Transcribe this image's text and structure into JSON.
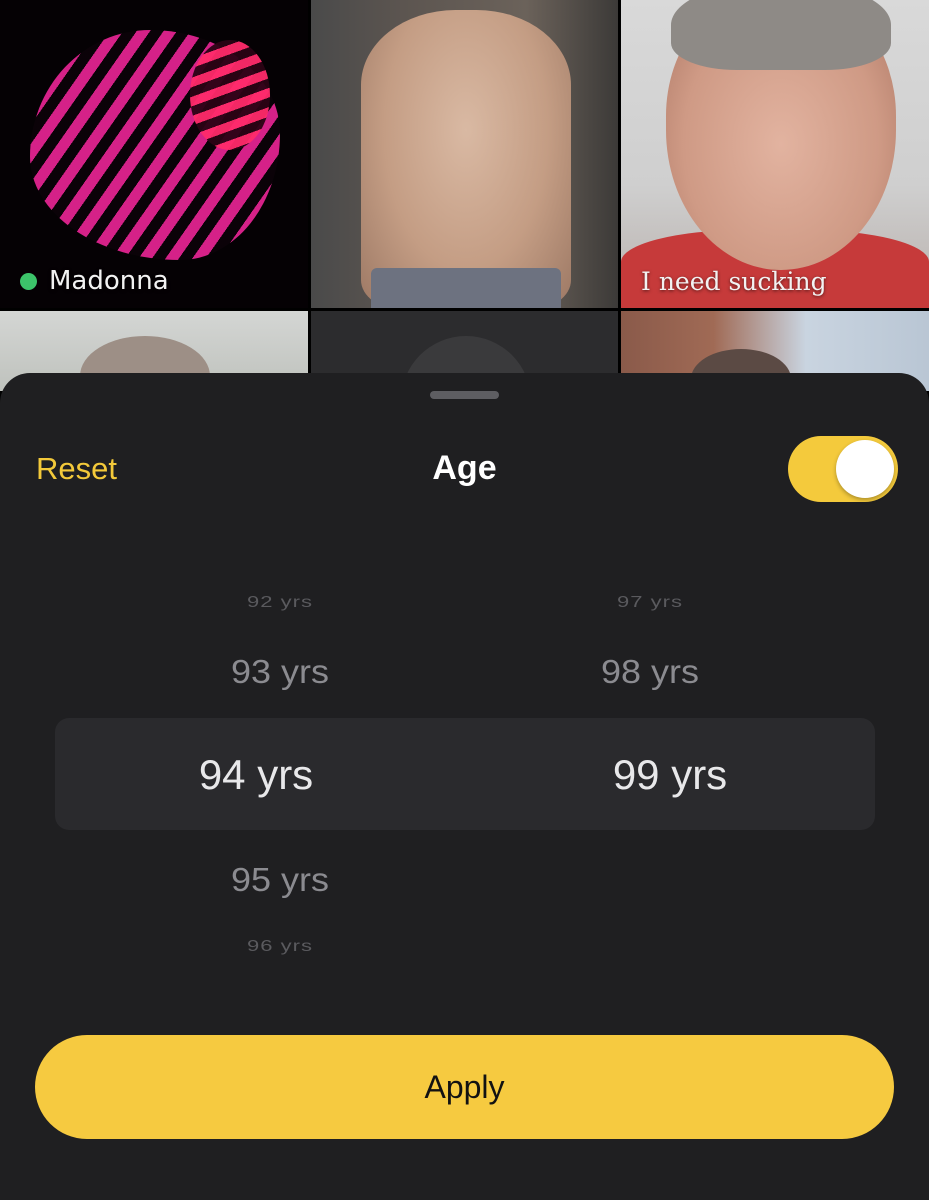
{
  "grid": {
    "profiles": [
      {
        "name": "Madonna",
        "online": true
      },
      {
        "name": ""
      },
      {
        "name": "I need sucking",
        "online": false
      }
    ]
  },
  "sheet": {
    "reset_label": "Reset",
    "title": "Age",
    "toggle_on": true,
    "picker": {
      "min": {
        "items": [
          "92 yrs",
          "93 yrs",
          "94 yrs",
          "95 yrs",
          "96 yrs"
        ],
        "selected": "94 yrs"
      },
      "max": {
        "items": [
          "97 yrs",
          "98 yrs",
          "99 yrs"
        ],
        "selected": "99 yrs"
      }
    },
    "apply_label": "Apply"
  },
  "colors": {
    "accent": "#f6ca40",
    "sheet_background": "#1f1f21",
    "online": "#3cc46a"
  }
}
